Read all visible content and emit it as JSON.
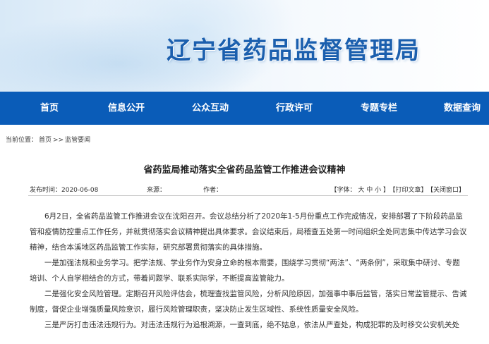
{
  "header": {
    "title": "辽宁省药品监督管理局"
  },
  "nav": {
    "items": [
      {
        "label": "首页"
      },
      {
        "label": "信息公开"
      },
      {
        "label": "公众互动"
      },
      {
        "label": "行政许可"
      },
      {
        "label": "专题专栏"
      },
      {
        "label": "数据查询"
      }
    ]
  },
  "breadcrumb": {
    "prefix": "当前位置：",
    "home": "首页",
    "sep": ">>",
    "section": "监管要闻"
  },
  "article": {
    "title": "省药监局推动落实全省药品监管工作推进会议精神",
    "publish": "发布时间：2020-06-08",
    "source": "来源：",
    "author": "作者：",
    "font_tool": "【字体： 大 中 小 】",
    "print_tool": "【打印文章】",
    "close_tool": "【关闭窗口】",
    "paragraphs": [
      "6月2日，全省药品监管工作推进会议在沈阳召开。会议总结分析了2020年1-5月份重点工作完成情况，安排部署了下阶段药品监管和疫情防控重点工作任务，并就贯彻落实会议精神提出具体要求。会议结束后，局稽查五处第一时间组织全处同志集中传达学习会议精神，结合本溪地区药品监管工作实际，研究部署贯彻落实的具体措施。",
      "一是加强法规和业务学习。把学法规、学业务作为安身立命的根本需要，围绕学习贯彻“两法”、“两条例”，采取集中研讨、专题培训、个人自学相结合的方式，带着问题学、联系实际学，不断提高监管能力。",
      "二是强化安全风险管理。定期召开风险评估会，梳理查找监管风险，分析风险原因，加强事中事后监管，落实日常监管提示、告诫制度，督促企业增强质量风险意识，履行风险管理职责，坚决防止发生区域性、系统性质量安全风险。",
      "三是严厉打击违法违规行为。对违法违规行为追根溯源，一查到底，绝不姑息，依法从严查处，构成犯罪的及时移交公安机关处"
    ]
  }
}
